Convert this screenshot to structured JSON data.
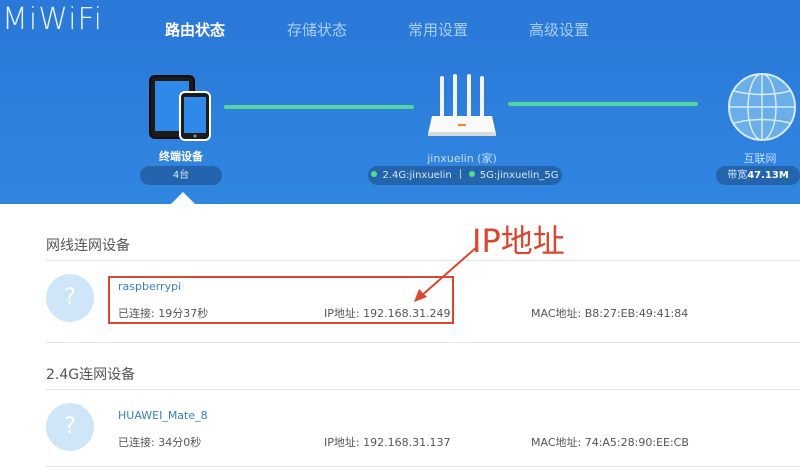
{
  "header": {
    "logo": "MiWiFi",
    "nav": [
      {
        "label": "路由状态",
        "active": true
      },
      {
        "label": "存储状态",
        "active": false
      },
      {
        "label": "常用设置",
        "active": false
      },
      {
        "label": "高级设置",
        "active": false
      }
    ]
  },
  "topology": {
    "devices": {
      "label": "终端设备",
      "count": "4台"
    },
    "router": {
      "name": "jinxuelin (家)",
      "band_24": "2.4G:jinxuelin",
      "band_5": "5G:jinxuelin_5G"
    },
    "internet": {
      "label": "互联网",
      "bandwidth_prefix": "带宽",
      "bandwidth_value": "47.13M"
    }
  },
  "annotation": {
    "text": "IP地址",
    "color": "#d9472f"
  },
  "sections": [
    {
      "title": "网线连网设备",
      "devices": [
        {
          "name": "raspberrypi",
          "avatar": "?",
          "connected": "已连接: 19分37秒",
          "ip": "IP地址: 192.168.31.249",
          "mac": "MAC地址: B8:27:EB:49:41:84"
        }
      ]
    },
    {
      "title": "2.4G连网设备",
      "devices": [
        {
          "name": "HUAWEI_Mate_8",
          "avatar": "?",
          "connected": "已连接: 34分0秒",
          "ip": "IP地址: 192.168.31.137",
          "mac": "MAC地址: 74:A5:28:90:EE:CB"
        }
      ]
    }
  ],
  "colors": {
    "header_blue": "#2f7fd9",
    "link_green": "#53d6a4",
    "highlight_red": "#d9472f"
  }
}
